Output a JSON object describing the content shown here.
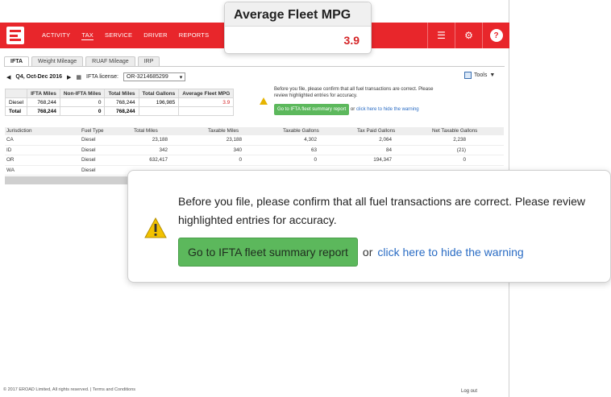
{
  "nav": {
    "items": [
      "ACTIVITY",
      "TAX",
      "SERVICE",
      "DRIVER",
      "REPORTS"
    ],
    "active": "TAX"
  },
  "top_icons": [
    "checklist-icon",
    "gear-icon",
    "help-icon"
  ],
  "tabs": [
    "IFTA",
    "Weight Mileage",
    "RUAF Mileage",
    "IRP"
  ],
  "period": {
    "quarter": "Q4, Oct-Dec 2016",
    "license_label": "IFTA license:",
    "license_value": "OR-3214685299"
  },
  "tools_label": "Tools",
  "summary": {
    "headers": [
      "",
      "IFTA Miles",
      "Non-IFTA Miles",
      "Total Miles",
      "Total Gallons",
      "Average Fleet MPG"
    ],
    "rows": [
      [
        "Diesel",
        "768,244",
        "0",
        "768,244",
        "196,985",
        "3.9"
      ],
      [
        "Total",
        "768,244",
        "0",
        "768,244",
        "",
        ""
      ]
    ]
  },
  "warning": {
    "text": "Before you file, please confirm that all fuel transactions are correct. Please review highlighted entries for accuracy.",
    "button": "Go to IFTA fleet summary report",
    "or": "or",
    "link": "click here to hide the warning"
  },
  "jurisdictions": {
    "headers": [
      "Jurisdiction",
      "Fuel Type",
      "Total Miles",
      "Taxable Miles",
      "Taxable Gallons",
      "Tax Paid Gallons",
      "Net Taxable Gallons"
    ],
    "rows": [
      [
        "CA",
        "Diesel",
        "23,188",
        "23,188",
        "4,302",
        "2,064",
        "2,238"
      ],
      [
        "ID",
        "Diesel",
        "342",
        "340",
        "63",
        "84",
        "(21)"
      ],
      [
        "OR",
        "Diesel",
        "632,417",
        "0",
        "0",
        "194,347",
        "0"
      ],
      [
        "WA",
        "Diesel",
        "",
        "",
        "",
        "",
        ""
      ]
    ]
  },
  "callout_mpg": {
    "title": "Average Fleet MPG",
    "value": "3.9"
  },
  "footer": {
    "copyright": "© 2017 EROAD Limited, All rights reserved.  |  Terms and Conditions",
    "logout": "Log out"
  },
  "colors": {
    "brand_red": "#e8262b",
    "button_green": "#5cb85c",
    "link_blue": "#2a6cc4",
    "warn_yellow": "#e6b400"
  }
}
